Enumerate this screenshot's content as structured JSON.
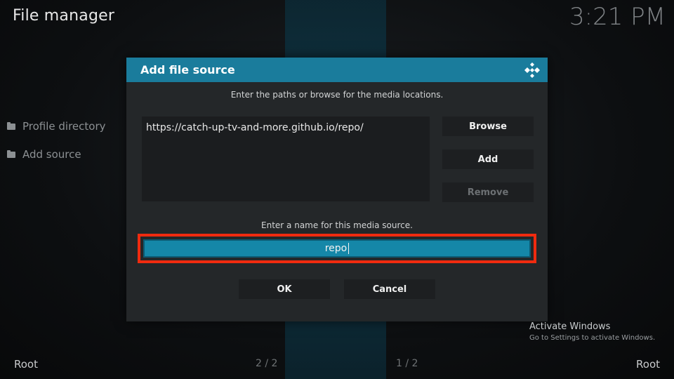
{
  "app": {
    "title": "File manager",
    "clock": "3:21 PM"
  },
  "sidebar": {
    "items": [
      {
        "label": "Profile directory",
        "icon": "folder-icon"
      },
      {
        "label": "Add source",
        "icon": "folder-icon"
      }
    ]
  },
  "dialog": {
    "title": "Add file source",
    "icon": "kodi-logo-icon",
    "paths_hint": "Enter the paths or browse for the media locations.",
    "paths": [
      "https://catch-up-tv-and-more.github.io/repo/"
    ],
    "browse_label": "Browse",
    "add_label": "Add",
    "remove_label": "Remove",
    "name_hint": "Enter a name for this media source.",
    "name_value": "repo",
    "ok_label": "OK",
    "cancel_label": "Cancel"
  },
  "watermark": {
    "title": "Activate Windows",
    "subtitle": "Go to Settings to activate Windows."
  },
  "footer": {
    "left_root": "Root",
    "left_page": "2 / 2",
    "right_page": "1 / 2",
    "right_root": "Root"
  },
  "colors": {
    "accent": "#1a7c9c",
    "input_bg": "#1587a8",
    "highlight": "#f02b0f",
    "dialog_bg": "#242729"
  }
}
